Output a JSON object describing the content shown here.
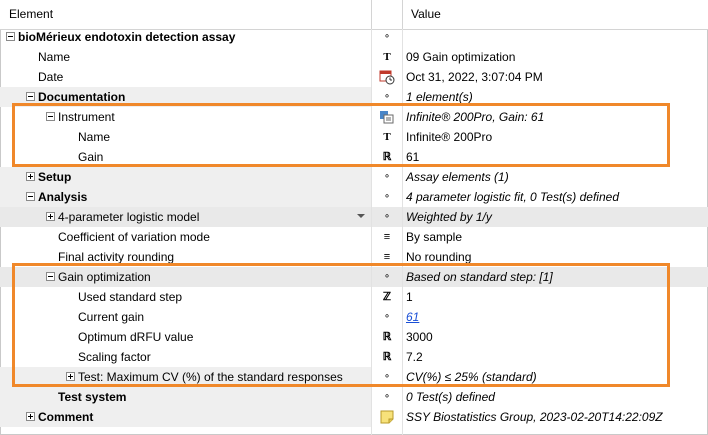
{
  "header": {
    "element": "Element",
    "value": "Value"
  },
  "rows": [
    {
      "label": "bioMérieux endotoxin detection assay",
      "value": "",
      "icon": "circle-icon"
    },
    {
      "label": "Name",
      "value": "09 Gain optimization",
      "icon": "text-type-icon"
    },
    {
      "label": "Date",
      "value": "Oct 31, 2022, 3:07:04 PM",
      "icon": "calendar-clock-icon"
    },
    {
      "label": "Documentation",
      "value": "1 element(s)",
      "icon": "circle-icon"
    },
    {
      "label": "Instrument",
      "value": "Infinite® 200Pro, Gain: 61",
      "icon": "instrument-icon"
    },
    {
      "label": "Name",
      "value": "Infinite® 200Pro",
      "icon": "text-type-icon"
    },
    {
      "label": "Gain",
      "value": "61",
      "icon": "real-number-icon"
    },
    {
      "label": "Setup",
      "value": "Assay elements (1)",
      "icon": "circle-icon"
    },
    {
      "label": "Analysis",
      "value": "4 parameter logistic fit, 0 Test(s) defined",
      "icon": "circle-icon"
    },
    {
      "label": "4-parameter logistic model",
      "value": "Weighted by 1/y",
      "icon": "circle-icon"
    },
    {
      "label": "Coefficient of variation mode",
      "value": "By sample",
      "icon": "list-icon"
    },
    {
      "label": "Final activity rounding",
      "value": "No rounding",
      "icon": "list-icon"
    },
    {
      "label": "Gain optimization",
      "value": "Based on standard step: [1]",
      "icon": "circle-icon"
    },
    {
      "label": "Used standard step",
      "value": "1",
      "icon": "integer-icon"
    },
    {
      "label": "Current gain",
      "value": "61",
      "icon": "circle-icon"
    },
    {
      "label": "Optimum dRFU value",
      "value": "3000",
      "icon": "real-number-icon"
    },
    {
      "label": "Scaling factor",
      "value": "7.2",
      "icon": "real-number-icon"
    },
    {
      "label": "Test: Maximum CV (%) of the standard responses",
      "value": "CV(%) ≤ 25% (standard)",
      "icon": "circle-icon"
    },
    {
      "label": "Test system",
      "value": "0 Test(s) defined",
      "icon": "circle-icon"
    },
    {
      "label": "Comment",
      "value": "SSY Biostatistics Group, 2023-02-20T14:22:09Z",
      "icon": "note-icon"
    }
  ],
  "glyphs": {
    "circle": "∘",
    "text": "T",
    "real": "ℝ",
    "integer": "ℤ",
    "list": "≡"
  },
  "colors": {
    "highlight": "#f0882a",
    "link": "#1a4fd6",
    "note": "#f7e27a"
  }
}
